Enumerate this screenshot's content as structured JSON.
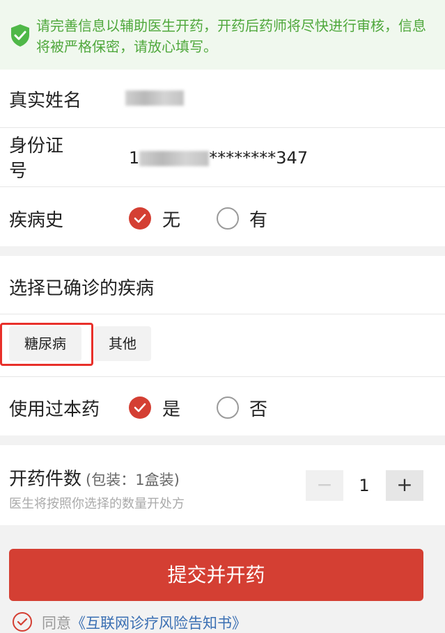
{
  "notice": {
    "icon": "shield-check-icon",
    "text": "请完善信息以辅助医生开药，开药后药师将尽快进行审核，信息将被严格保密，请放心填写。"
  },
  "form": {
    "name_label": "真实姓名",
    "id_label_line1": "身份证",
    "id_label_line2": "号",
    "id_prefix": "1",
    "id_suffix": "********347",
    "history_label": "疾病史",
    "history_options": [
      "无",
      "有"
    ],
    "history_selected": "无"
  },
  "diagnosis": {
    "title": "选择已确诊的疾病",
    "tags": [
      "糖尿病",
      "其他"
    ],
    "used_label": "使用过本药",
    "used_options": [
      "是",
      "否"
    ],
    "used_selected": "是"
  },
  "quantity": {
    "label": "开药件数",
    "package_note": "(包装：1盒装)",
    "hint": "医生将按照你选择的数量开处方",
    "value": "1",
    "minus": "−",
    "plus": "+"
  },
  "submit_label": "提交并开药",
  "agreement": {
    "prefix": "同意",
    "link": "《互联网诊疗风险告知书》"
  },
  "colors": {
    "accent": "#d43f33",
    "notice_green": "#4fa83c",
    "link_blue": "#3a6fb3"
  }
}
